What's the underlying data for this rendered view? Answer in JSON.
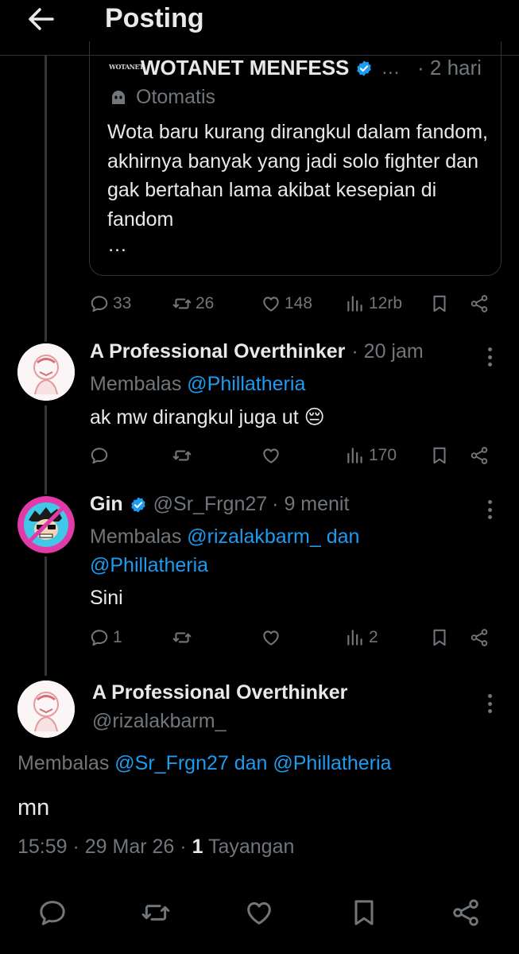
{
  "header": {
    "title": "Posting",
    "back_icon": "arrow-left-icon"
  },
  "quoted_post": {
    "logo_text": "WOTANET",
    "author": "WOTANET MENFESS",
    "ellipsis": "…",
    "time": "· 2 hari",
    "automated_label": "Otomatis",
    "text": "Wota baru kurang dirangkul dalam fandom, akhirnya banyak yang jadi solo fighter dan gak bertahan lama akibat kesepian di fandom",
    "more": "…"
  },
  "root_actions": {
    "replies": "33",
    "reposts": "26",
    "likes": "148",
    "views": "12rb"
  },
  "reply1": {
    "author": "A Professional Overthinker",
    "time": "· 20 jam",
    "reply_prefix": "Membalas",
    "reply_to": "@Phillatheria",
    "text": "ak mw dirangkul juga ut 😔",
    "actions": {
      "replies": "",
      "reposts": "",
      "likes": "",
      "views": "170"
    }
  },
  "reply2": {
    "author": "Gin",
    "handle": "@Sr_Frgn27",
    "time": "· 9 menit",
    "reply_prefix": "Membalas",
    "reply_to_line1": "@rizalakbarm_ dan",
    "reply_to_line2": "@Phillatheria",
    "text": "Sini",
    "actions": {
      "replies": "1",
      "reposts": "",
      "likes": "",
      "views": "2"
    }
  },
  "main_post": {
    "author": "A Professional Overthinker",
    "handle": "@rizalakbarm_",
    "reply_prefix": "Membalas",
    "reply_to": "@Sr_Frgn27 dan @Phillatheria",
    "text": "mn",
    "time": "15:59 · 29 Mar 26 · ",
    "views_count": "1",
    "views_label": " Tayangan"
  },
  "colors": {
    "background": "#000000",
    "text": "#e7e9ea",
    "muted": "#71767b",
    "accent": "#1d9bf0",
    "border": "#2f3336"
  },
  "icons": [
    "arrow-left-icon",
    "verified-badge-icon",
    "robot-icon",
    "reply-icon",
    "repost-icon",
    "like-icon",
    "views-icon",
    "bookmark-icon",
    "share-icon",
    "more-icon"
  ]
}
